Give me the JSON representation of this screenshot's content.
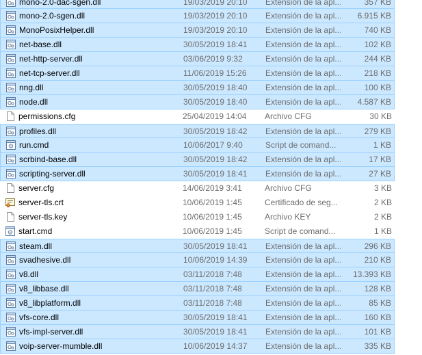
{
  "files": [
    {
      "name": "mono-2.0-dac-sgen.dll",
      "date": "19/03/2019 20:10",
      "type": "Extensión de la apl...",
      "size": "357 KB",
      "icon": "dll-icon",
      "selected": true
    },
    {
      "name": "mono-2.0-sgen.dll",
      "date": "19/03/2019 20:10",
      "type": "Extensión de la apl...",
      "size": "6.915 KB",
      "icon": "dll-icon",
      "selected": true
    },
    {
      "name": "MonoPosixHelper.dll",
      "date": "19/03/2019 20:10",
      "type": "Extensión de la apl...",
      "size": "740 KB",
      "icon": "dll-icon",
      "selected": true
    },
    {
      "name": "net-base.dll",
      "date": "30/05/2019 18:41",
      "type": "Extensión de la apl...",
      "size": "102 KB",
      "icon": "dll-icon",
      "selected": true
    },
    {
      "name": "net-http-server.dll",
      "date": "03/06/2019 9:32",
      "type": "Extensión de la apl...",
      "size": "244 KB",
      "icon": "dll-icon",
      "selected": true
    },
    {
      "name": "net-tcp-server.dll",
      "date": "11/06/2019 15:26",
      "type": "Extensión de la apl...",
      "size": "218 KB",
      "icon": "dll-icon",
      "selected": true
    },
    {
      "name": "nng.dll",
      "date": "30/05/2019 18:40",
      "type": "Extensión de la apl...",
      "size": "100 KB",
      "icon": "dll-icon",
      "selected": true
    },
    {
      "name": "node.dll",
      "date": "30/05/2019 18:40",
      "type": "Extensión de la apl...",
      "size": "4.587 KB",
      "icon": "dll-icon",
      "selected": true
    },
    {
      "name": "permissions.cfg",
      "date": "25/04/2019 14:04",
      "type": "Archivo CFG",
      "size": "30 KB",
      "icon": "file-icon",
      "selected": false
    },
    {
      "name": "profiles.dll",
      "date": "30/05/2019 18:42",
      "type": "Extensión de la apl...",
      "size": "279 KB",
      "icon": "dll-icon",
      "selected": true
    },
    {
      "name": "run.cmd",
      "date": "10/06/2017 9:40",
      "type": "Script de comand...",
      "size": "1 KB",
      "icon": "cmd-icon",
      "selected": true
    },
    {
      "name": "scrbind-base.dll",
      "date": "30/05/2019 18:42",
      "type": "Extensión de la apl...",
      "size": "17 KB",
      "icon": "dll-icon",
      "selected": true
    },
    {
      "name": "scripting-server.dll",
      "date": "30/05/2019 18:41",
      "type": "Extensión de la apl...",
      "size": "27 KB",
      "icon": "dll-icon",
      "selected": true
    },
    {
      "name": "server.cfg",
      "date": "14/06/2019 3:41",
      "type": "Archivo CFG",
      "size": "3 KB",
      "icon": "file-icon",
      "selected": false
    },
    {
      "name": "server-tls.crt",
      "date": "10/06/2019 1:45",
      "type": "Certificado de seg...",
      "size": "2 KB",
      "icon": "certificate-icon",
      "selected": false
    },
    {
      "name": "server-tls.key",
      "date": "10/06/2019 1:45",
      "type": "Archivo KEY",
      "size": "2 KB",
      "icon": "file-icon",
      "selected": false
    },
    {
      "name": "start.cmd",
      "date": "10/06/2019 1:45",
      "type": "Script de comand...",
      "size": "1 KB",
      "icon": "cmd-icon",
      "selected": false
    },
    {
      "name": "steam.dll",
      "date": "30/05/2019 18:41",
      "type": "Extensión de la apl...",
      "size": "296 KB",
      "icon": "dll-icon",
      "selected": true
    },
    {
      "name": "svadhesive.dll",
      "date": "10/06/2019 14:39",
      "type": "Extensión de la apl...",
      "size": "210 KB",
      "icon": "dll-icon",
      "selected": true
    },
    {
      "name": "v8.dll",
      "date": "03/11/2018 7:48",
      "type": "Extensión de la apl...",
      "size": "13.393 KB",
      "icon": "dll-icon",
      "selected": true
    },
    {
      "name": "v8_libbase.dll",
      "date": "03/11/2018 7:48",
      "type": "Extensión de la apl...",
      "size": "128 KB",
      "icon": "dll-icon",
      "selected": true
    },
    {
      "name": "v8_libplatform.dll",
      "date": "03/11/2018 7:48",
      "type": "Extensión de la apl...",
      "size": "85 KB",
      "icon": "dll-icon",
      "selected": true
    },
    {
      "name": "vfs-core.dll",
      "date": "30/05/2019 18:41",
      "type": "Extensión de la apl...",
      "size": "160 KB",
      "icon": "dll-icon",
      "selected": true
    },
    {
      "name": "vfs-impl-server.dll",
      "date": "30/05/2019 18:41",
      "type": "Extensión de la apl...",
      "size": "101 KB",
      "icon": "dll-icon",
      "selected": true
    },
    {
      "name": "voip-server-mumble.dll",
      "date": "10/06/2019 14:37",
      "type": "Extensión de la apl...",
      "size": "335 KB",
      "icon": "dll-icon",
      "selected": true
    }
  ],
  "colors": {
    "selection_bg": "#cce8ff",
    "selection_border": "#99d1ff",
    "secondary_text": "#6d6d6d"
  }
}
